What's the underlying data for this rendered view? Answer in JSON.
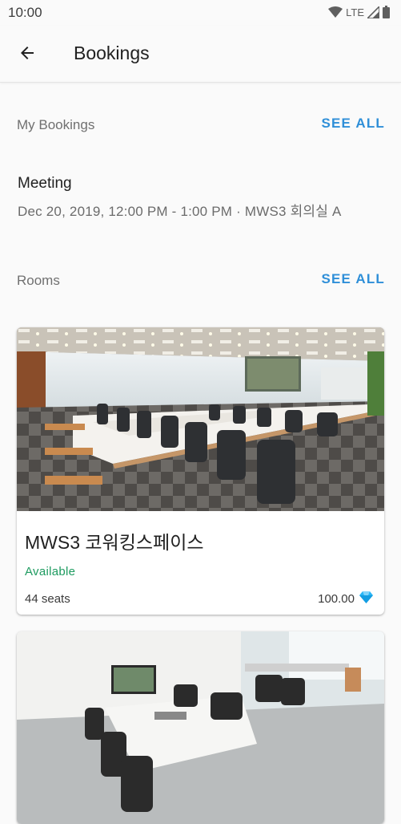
{
  "status_bar": {
    "time": "10:00",
    "network": "LTE"
  },
  "app_bar": {
    "title": "Bookings",
    "back_icon": "arrow-back-icon"
  },
  "my_bookings": {
    "section_title": "My Bookings",
    "see_all_label": "SEE ALL",
    "item": {
      "title": "Meeting",
      "detail": "Dec 20, 2019, 12:00 PM - 1:00 PM · MWS3 회의실 A"
    }
  },
  "rooms": {
    "section_title": "Rooms",
    "see_all_label": "SEE ALL",
    "items": [
      {
        "name": "MWS3 코워킹스페이스",
        "status": "Available",
        "seats": "44 seats",
        "price": "100.00",
        "price_icon": "diamond-icon"
      },
      {
        "name": "",
        "status": "",
        "seats": "",
        "price": ""
      }
    ]
  },
  "colors": {
    "accent": "#2f8fd8",
    "available": "#1e9b60",
    "diamond": "#29b6f6"
  }
}
